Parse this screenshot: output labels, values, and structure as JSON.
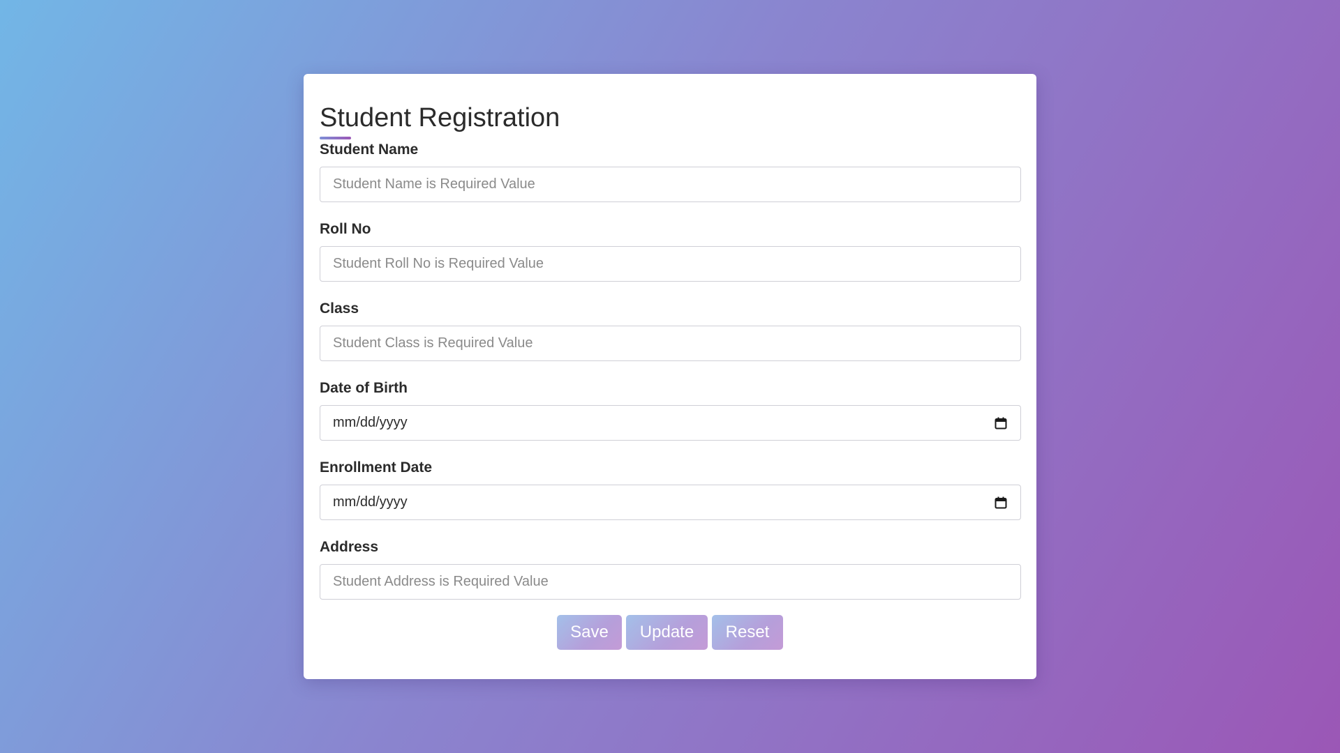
{
  "form": {
    "title": "Student Registration",
    "fields": [
      {
        "label": "Student Name",
        "type": "text",
        "value": "",
        "placeholder": "Student Name is Required Value"
      },
      {
        "label": "Roll No",
        "type": "text",
        "value": "",
        "placeholder": "Student Roll No is Required Value"
      },
      {
        "label": "Class",
        "type": "text",
        "value": "",
        "placeholder": "Student Class is Required Value"
      },
      {
        "label": "Date of Birth",
        "type": "date",
        "value": "mm/dd/yyyy",
        "icon": "calendar-icon"
      },
      {
        "label": "Enrollment Date",
        "type": "date",
        "value": "mm/dd/yyyy",
        "icon": "calendar-icon"
      },
      {
        "label": "Address",
        "type": "text",
        "value": "",
        "placeholder": "Student Address is Required Value"
      }
    ],
    "buttons": {
      "save_label": "Save",
      "update_label": "Update",
      "reset_label": "Reset"
    }
  },
  "colors": {
    "background_start": "#72b6e6",
    "background_end": "#9b57b6",
    "card": "#ffffff",
    "button_gradient_start": "#9fbde8",
    "button_gradient_end": "#c196d4"
  }
}
